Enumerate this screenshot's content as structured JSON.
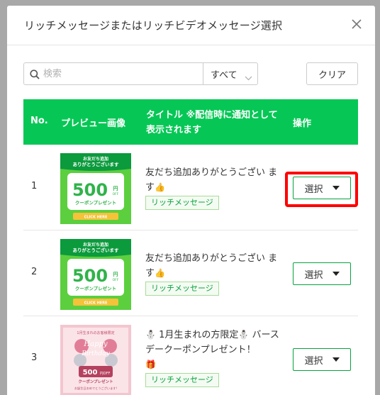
{
  "modal": {
    "title": "リッチメッセージまたはリッチビデオメッセージ選択"
  },
  "search": {
    "placeholder": "検索",
    "filter_label": "すべて",
    "clear_label": "クリア"
  },
  "table": {
    "headers": {
      "no": "No.",
      "preview": "プレビュー画像",
      "title": "タイトル ※配信時に通知として表示されます",
      "action": "操作"
    },
    "rows": [
      {
        "no": "1",
        "title": "友だち追加ありがとうござい ます",
        "title_emoji": "👍",
        "tag": "リッチメッセージ",
        "button_label": "選択",
        "thumb": {
          "line1": "お友だち追加",
          "line2": "ありがとうございます",
          "amount": "500",
          "yen": "円",
          "off": "OFF",
          "coupon": "クーポンプレゼント",
          "cta": "CLICK HERE"
        }
      },
      {
        "no": "2",
        "title": "友だち追加ありがとうござい ます",
        "title_emoji": "👍",
        "tag": "リッチメッセージ",
        "button_label": "選択",
        "thumb": {
          "line1": "お友だち追加",
          "line2": "ありがとうございます",
          "amount": "500",
          "yen": "円",
          "off": "OFF",
          "coupon": "クーポンプレゼント",
          "cta": "CLICK HERE"
        }
      },
      {
        "no": "3",
        "title_prefix_emoji": "⛄",
        "title": "1月生まれの方限定",
        "title_mid_emoji": "⛄",
        "title_suffix": "バースデークーポンプレゼント！",
        "title_end_emoji": "🎁",
        "tag": "リッチメッセージ",
        "button_label": "選択",
        "thumb": {
          "top": "1月生まれのお客様限定",
          "happy": "Happy",
          "birthday": "Birthday",
          "amount": "500",
          "off": "円OFF",
          "coupon": "クーポンプレゼント",
          "bottom": "お誕生日おめでとうございます!"
        }
      }
    ]
  },
  "colors": {
    "accent": "#06c755",
    "highlight": "#ff0000"
  }
}
